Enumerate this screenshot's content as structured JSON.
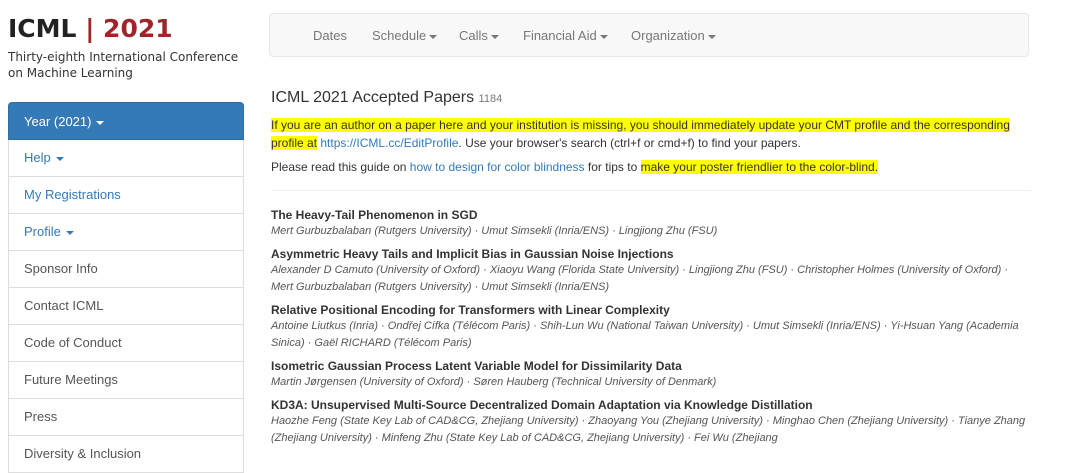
{
  "header": {
    "logo_name": "ICML",
    "logo_separator": "|",
    "logo_year": "2021",
    "subtitle": "Thirty-eighth International Conference on Machine Learning"
  },
  "nav": {
    "items": [
      {
        "label": "Dates",
        "dropdown": false
      },
      {
        "label": "Schedule",
        "dropdown": true
      },
      {
        "label": "Calls",
        "dropdown": true
      },
      {
        "label": "Financial Aid",
        "dropdown": true
      },
      {
        "label": "Organization",
        "dropdown": true
      }
    ]
  },
  "sidebar": {
    "items": [
      {
        "label": "Year (2021)",
        "dropdown": true,
        "active": true
      },
      {
        "label": "Help",
        "dropdown": true
      },
      {
        "label": "My Registrations"
      },
      {
        "label": "Profile",
        "dropdown": true
      },
      {
        "label": "Sponsor Info"
      },
      {
        "label": "Contact ICML"
      },
      {
        "label": "Code of Conduct"
      },
      {
        "label": "Future Meetings"
      },
      {
        "label": "Press"
      },
      {
        "label": "Diversity & Inclusion"
      }
    ]
  },
  "main": {
    "title": "ICML 2021 Accepted Papers",
    "count": "1184",
    "notice_highlight": "If you are an author on a paper here and your institution is missing, you should immediately update your CMT profile and the corresponding profile at",
    "notice_link": "https://ICML.cc/EditProfile",
    "notice_rest": ". Use your browser's search (ctrl+f or cmd+f) to find your papers.",
    "guide_pre": "Please read this guide on",
    "guide_link": "how to design for color blindness",
    "guide_mid": "for tips to",
    "guide_highlight": "make your poster friendlier to the color-blind."
  },
  "papers": [
    {
      "title": "The Heavy-Tail Phenomenon in SGD",
      "authors": "Mert Gurbuzbalaban (Rutgers University) · Umut Simsekli (Inria/ENS) · Lingjiong Zhu (FSU)"
    },
    {
      "title": "Asymmetric Heavy Tails and Implicit Bias in Gaussian Noise Injections",
      "authors": "Alexander D Camuto (University of Oxford) · Xiaoyu Wang (Florida State University) · Lingjiong Zhu (FSU) · Christopher Holmes (University of Oxford) · Mert Gurbuzbalaban (Rutgers University) · Umut Simsekli (Inria/ENS)"
    },
    {
      "title": "Relative Positional Encoding for Transformers with Linear Complexity",
      "authors": "Antoine Liutkus (Inria) · Ondřej Cífka (Télécom Paris) · Shih-Lun Wu (National Taiwan University) · Umut Simsekli (Inria/ENS) · Yi-Hsuan Yang (Academia Sinica) · Gaël RICHARD (Télécom Paris)"
    },
    {
      "title": "Isometric Gaussian Process Latent Variable Model for Dissimilarity Data",
      "authors": "Martin Jørgensen (University of Oxford) · Søren Hauberg (Technical University of Denmark)"
    },
    {
      "title": "KD3A: Unsupervised Multi-Source Decentralized Domain Adaptation via Knowledge Distillation",
      "authors": "Haozhe Feng (State Key Lab of CAD&CG, Zhejiang University) · Zhaoyang You (Zhejiang University) · Minghao Chen (Zhejiang University) · Tianye Zhang (Zhejiang University) · Minfeng Zhu (State Key Lab of CAD&CG, Zhejiang University) · Fei Wu (Zhejiang"
    }
  ]
}
